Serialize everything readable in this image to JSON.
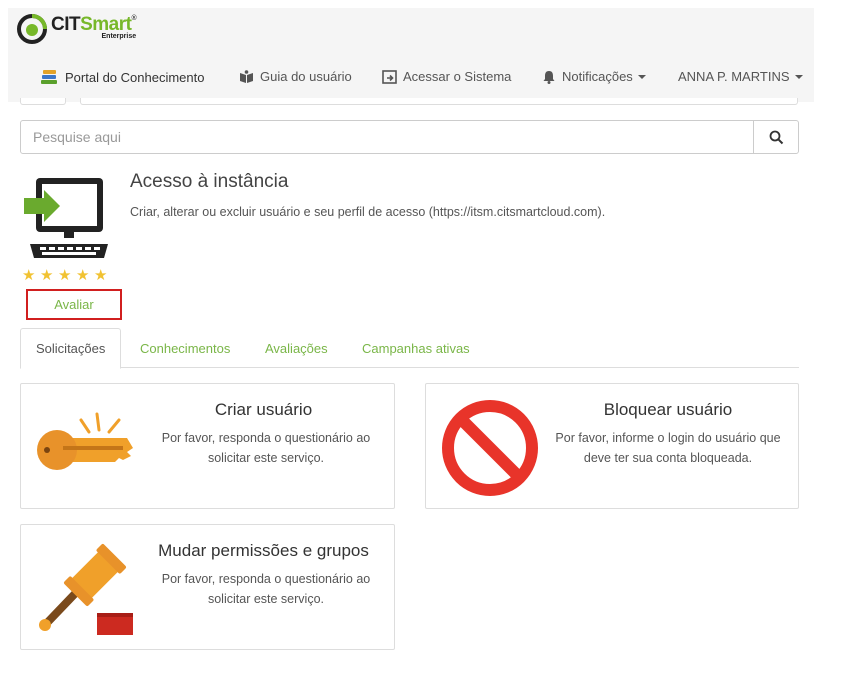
{
  "brand": {
    "name_part1": "CIT",
    "name_part2": "Smart",
    "registered": "®",
    "subtitle": "Enterprise",
    "accent_color": "#77b82a"
  },
  "nav": {
    "items": [
      {
        "label": "Portal do Conhecimento",
        "icon": "books-icon"
      },
      {
        "label": "Guia do usuário",
        "icon": "open-book-icon"
      },
      {
        "label": "Acessar o Sistema",
        "icon": "login-icon"
      },
      {
        "label": "Notificações",
        "icon": "bell-icon"
      },
      {
        "label": "ANNA P. MARTINS",
        "icon": "caret-down-icon"
      }
    ]
  },
  "search": {
    "placeholder": "Pesquise aqui",
    "value": ""
  },
  "service": {
    "title": "Acesso à instância",
    "description": "Criar, alterar ou excluir usuário e seu perfil de acesso (https://itsm.citsmartcloud.com).",
    "rating_stars": 5,
    "star_glyph": "★",
    "rate_label": "Avaliar"
  },
  "tabs": [
    {
      "label": "Solicitações",
      "active": true
    },
    {
      "label": "Conhecimentos",
      "active": false
    },
    {
      "label": "Avaliações",
      "active": false
    },
    {
      "label": "Campanhas ativas",
      "active": false
    }
  ],
  "cards": [
    {
      "title": "Criar usuário",
      "description": "Por favor, responda o questionário ao solicitar este serviço.",
      "icon": "key-icon"
    },
    {
      "title": "Bloquear usuário",
      "description": "Por favor, informe o login do usuário que deve ter sua conta bloqueada.",
      "icon": "prohibited-icon"
    },
    {
      "title": "Mudar permissões e grupos",
      "description": "Por favor, responda o questionário ao solicitar este serviço.",
      "icon": "gavel-icon"
    }
  ]
}
